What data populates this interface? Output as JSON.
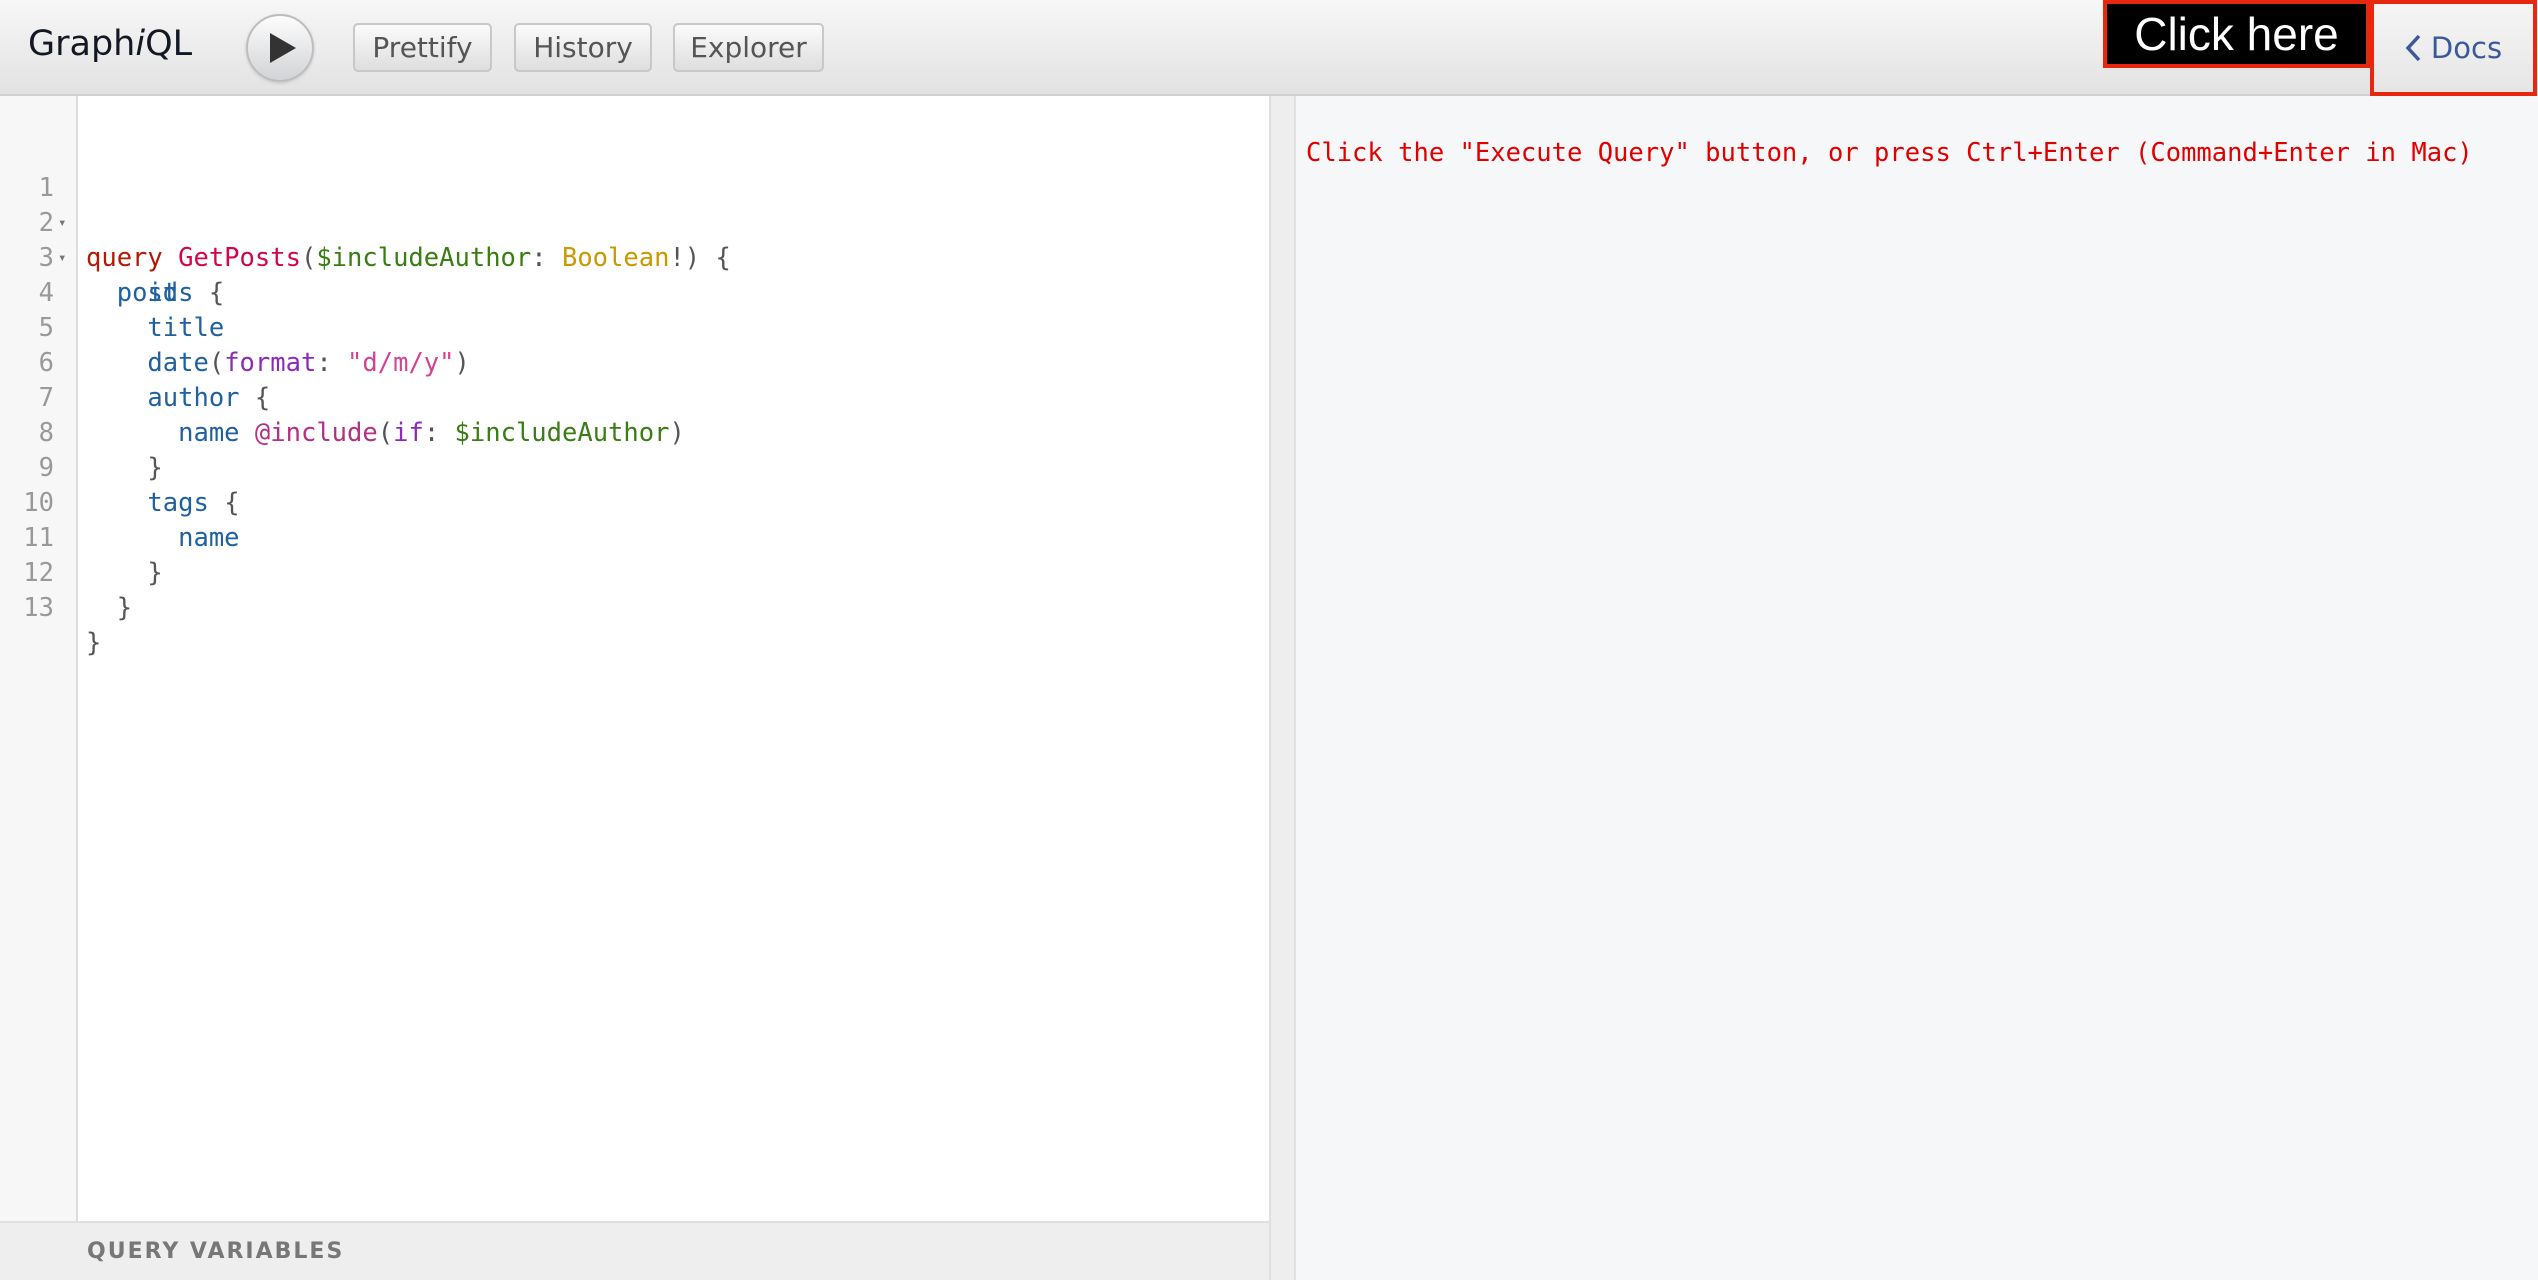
{
  "header": {
    "title_prefix": "Graph",
    "title_italic": "i",
    "title_suffix": "QL",
    "execute_icon": "play-icon",
    "buttons": {
      "prettify": "Prettify",
      "history": "History",
      "explorer": "Explorer"
    },
    "annotation": "Click here",
    "docs": {
      "icon": "chevron-left-icon",
      "label": "Docs"
    }
  },
  "editor": {
    "lines": [
      {
        "num": "1",
        "fold": true
      },
      {
        "num": "2",
        "fold": true
      },
      {
        "num": "3",
        "fold": false
      },
      {
        "num": "4",
        "fold": false
      },
      {
        "num": "5",
        "fold": false
      },
      {
        "num": "6",
        "fold": false
      },
      {
        "num": "7",
        "fold": false
      },
      {
        "num": "8",
        "fold": false
      },
      {
        "num": "9",
        "fold": false
      },
      {
        "num": "10",
        "fold": false
      },
      {
        "num": "11",
        "fold": false
      },
      {
        "num": "12",
        "fold": false
      },
      {
        "num": "13",
        "fold": false
      }
    ],
    "fold_icon": "▾",
    "tokens": {
      "l1": {
        "kw": "query",
        "def": "GetPosts",
        "p1": "(",
        "var": "$includeAuthor",
        "p2": ": ",
        "type": "Boolean",
        "p3": "!) {"
      },
      "l2": {
        "field": "posts",
        "p": " {"
      },
      "l3": {
        "field": "id"
      },
      "l4": {
        "field": "title"
      },
      "l5": {
        "field": "date",
        "p1": "(",
        "attr": "format",
        "p2": ": ",
        "str": "\"d/m/y\"",
        "p3": ")"
      },
      "l6": {
        "field": "author",
        "p": " {"
      },
      "l7": {
        "field": "name",
        "dir": "@include",
        "p1": "(",
        "attr": "if",
        "p2": ": ",
        "var": "$includeAuthor",
        "p3": ")"
      },
      "l8": {
        "p": "}"
      },
      "l9": {
        "field": "tags",
        "p": " {"
      },
      "l10": {
        "field": "name"
      },
      "l11": {
        "p": "}"
      },
      "l12": {
        "p": "}"
      },
      "l13": {
        "p": "}"
      }
    }
  },
  "variables": {
    "title": "QUERY VARIABLES"
  },
  "result": {
    "message": "Click the \"Execute Query\" button, or press Ctrl+Enter (Command+Enter in Mac)"
  }
}
